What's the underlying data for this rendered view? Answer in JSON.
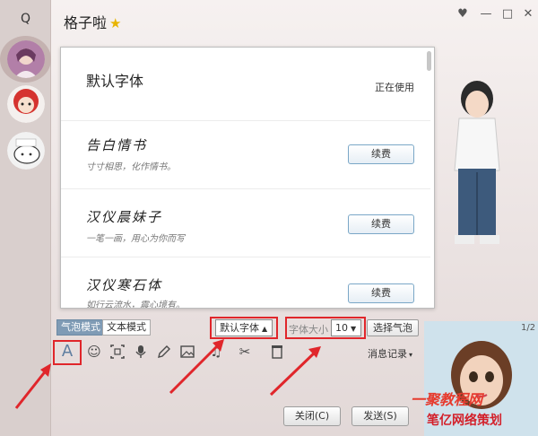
{
  "chat": {
    "title": "格子啦",
    "title_badge": "★"
  },
  "window_controls": {
    "skin": "♥",
    "minimize": "—",
    "maximize": "□",
    "close": "✕"
  },
  "sidebar": {
    "search_icon": "Q"
  },
  "font_popup": {
    "items": [
      {
        "name": "默认字体",
        "status": "正在使用"
      },
      {
        "name": "告白情书",
        "desc": "寸寸相思，化作情书。",
        "action": "续费"
      },
      {
        "name": "汉仪晨妹子",
        "desc": "一笔一画，用心为你而写",
        "action": "续费"
      },
      {
        "name": "汉仪寒石体",
        "desc": "如行云流水，震心境有。",
        "action": "续费"
      }
    ]
  },
  "bubble_bar": {
    "bubble_mode": "气泡模式",
    "text_mode": "文本模式",
    "font_select": "默认字体",
    "font_size_label": "字体大小",
    "font_size_value": "10",
    "choose_bubble": "选择气泡"
  },
  "toolbar": {
    "font_icon": "A",
    "history": "消息记录"
  },
  "page_indicator": "1/2",
  "buttons": {
    "close": "关闭(C)",
    "send": "发送(S)"
  },
  "watermark": {
    "line1": "一聚教程网",
    "line2": "笔亿网络策划"
  },
  "colors": {
    "accent_red": "#e0262b",
    "mode_active": "#7f9bb5",
    "renew_border": "#7aa7c7"
  }
}
